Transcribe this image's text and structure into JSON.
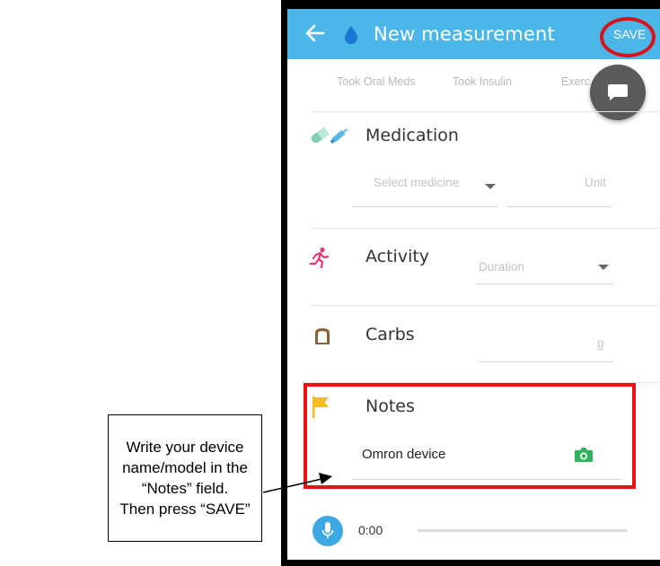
{
  "appbar": {
    "title": "New measurement",
    "save_label": "SAVE",
    "color": "#4db6e8"
  },
  "tabs": [
    "Took Oral Meds",
    "Took Insulin",
    "Exerc"
  ],
  "medication": {
    "title": "Medication",
    "medicine_placeholder": "Select medicine",
    "unit_placeholder": "Unit"
  },
  "activity": {
    "title": "Activity",
    "duration_placeholder": "Duration"
  },
  "carbs": {
    "title": "Carbs",
    "unit": "g"
  },
  "notes": {
    "title": "Notes",
    "value": "Omron device"
  },
  "recorder": {
    "time": "0:00"
  },
  "callout": {
    "text": "Write your device\nname/model in the\n“Notes” field.\nThen press “SAVE”"
  },
  "icons": {
    "back": "back-arrow-icon",
    "drop": "blood-drop-icon",
    "chat": "chat-bubble-icon",
    "medication": "pill-syringe-icon",
    "activity": "running-person-icon",
    "carbs": "bread-icon",
    "notes": "flag-icon",
    "camera": "camera-icon",
    "mic": "microphone-icon"
  },
  "colors": {
    "highlight": "#ee1111",
    "activity": "#e8336e",
    "notes_flag": "#f6bd20",
    "camera": "#2fb35b"
  }
}
